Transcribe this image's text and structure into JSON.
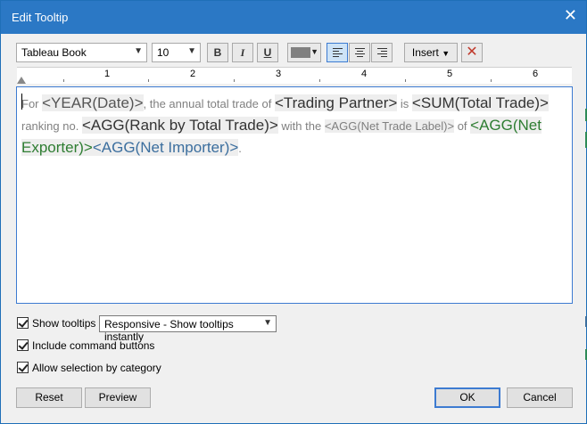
{
  "window": {
    "title": "Edit Tooltip"
  },
  "toolbar": {
    "font": "Tableau Book",
    "size": "10",
    "bold": "B",
    "italic": "I",
    "underline": "U",
    "insert_label": "Insert",
    "clear_symbol": "✕",
    "text_color": "#808080"
  },
  "ruler": {
    "labels": [
      "1",
      "2",
      "3",
      "4",
      "5",
      "6"
    ]
  },
  "editor": {
    "t1": "For ",
    "f1": "<YEAR(Date)>",
    "t2": ", the annual total trade of ",
    "f2": "<Trading Partner>",
    "t3": " is ",
    "f3": "<SUM(Total Trade)>",
    "t4": " ranking no. ",
    "f4": "<AGG(Rank by Total Trade)>",
    "t5": " with the ",
    "f5": "<AGG(Net Trade Label)>",
    "t6": " of ",
    "f6": "<AGG(Net Exporter)>",
    "f7": "<AGG(Net Importer)>",
    "t7": "."
  },
  "options": {
    "show_tooltips": {
      "label": "Show tooltips",
      "checked": true
    },
    "tooltip_mode": "Responsive - Show tooltips instantly",
    "include_command_buttons": {
      "label": "Include command buttons",
      "checked": true
    },
    "allow_selection_by_category": {
      "label": "Allow selection by category",
      "checked": true
    }
  },
  "buttons": {
    "reset": "Reset",
    "preview": "Preview",
    "ok": "OK",
    "cancel": "Cancel"
  },
  "colors": {
    "title_bar": "#2b78c5",
    "net_exporter": "#2e7d32",
    "net_importer": "#3b6e9e"
  }
}
